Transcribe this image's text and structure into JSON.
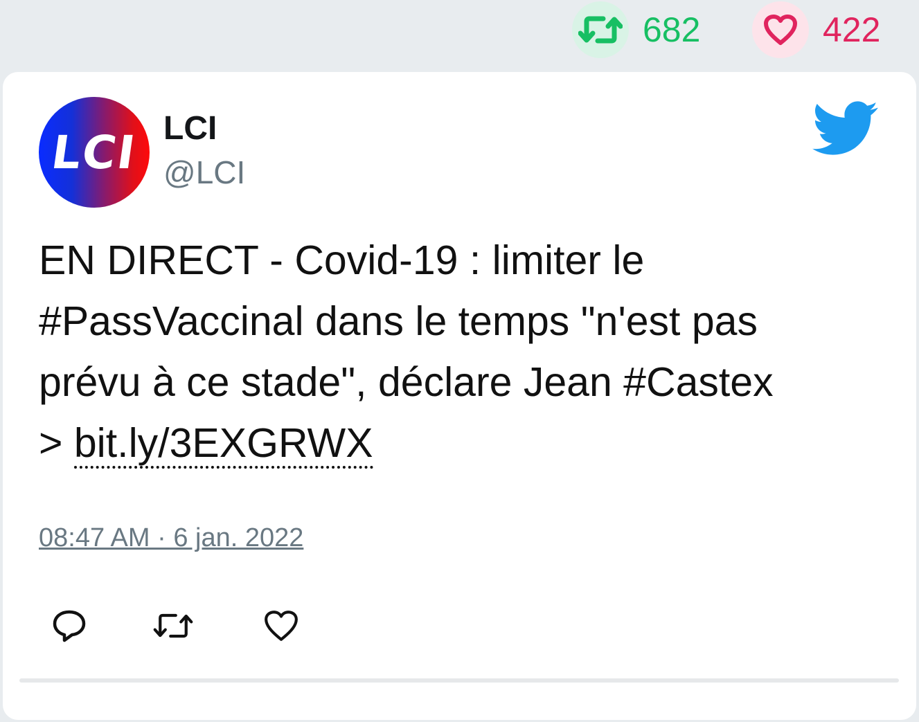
{
  "stats": {
    "retweet_count": "682",
    "like_count": "422",
    "retweet_color": "#17bf63",
    "like_color": "#e0245e"
  },
  "author": {
    "avatar_text": "LCI",
    "name": "LCI",
    "handle": "@LCI"
  },
  "tweet": {
    "text_lines": [
      "EN DIRECT - Covid-19 : limiter le",
      "#PassVaccinal dans le temps \"n'est pas",
      "prévu à ce stade\", déclare Jean #Castex",
      "> "
    ],
    "link": "bit.ly/3EXGRWX",
    "timestamp": "08:47 AM · 6 jan. 2022"
  },
  "icons": {
    "top_retweet": "retweet-icon",
    "top_like": "heart-icon",
    "brand": "twitter-bird-icon",
    "reply": "reply-icon",
    "retweet": "retweet-icon",
    "like": "heart-icon"
  },
  "colors": {
    "brand_blue": "#1d9bf0",
    "text_gray": "#697882"
  }
}
